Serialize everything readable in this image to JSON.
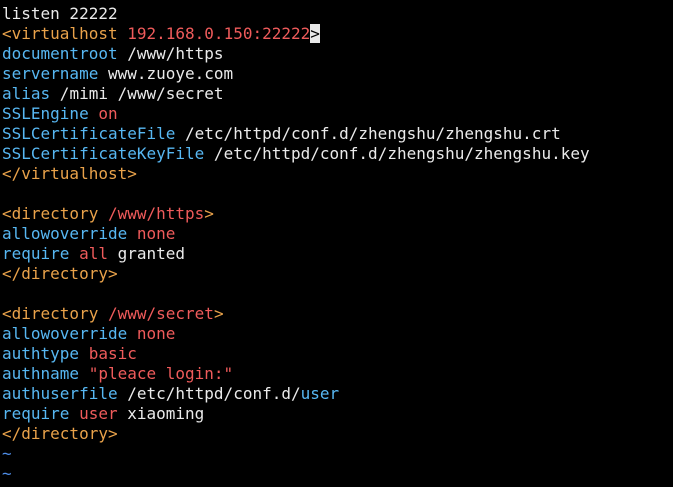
{
  "colors": {
    "background": "#000000",
    "normal": "#eaeaea",
    "keyword": "#57b7f2",
    "value": "#ef5b5b",
    "tag": "#e9a24a",
    "tilde": "#4f8ee8",
    "cursor_bg": "#e8e8e8"
  },
  "editor": {
    "lines": [
      [
        {
          "t": "listen 22222",
          "c": "normal"
        }
      ],
      [
        {
          "t": "<virtualhost ",
          "c": "tag"
        },
        {
          "t": "192.168.0.150:22222",
          "c": "value"
        },
        {
          "t": ">",
          "c": "cursor"
        }
      ],
      [
        {
          "t": "documentroot",
          "c": "keyword"
        },
        {
          "t": " /www/https",
          "c": "normal"
        }
      ],
      [
        {
          "t": "servername",
          "c": "keyword"
        },
        {
          "t": " www.zuoye.com",
          "c": "normal"
        }
      ],
      [
        {
          "t": "alias",
          "c": "keyword"
        },
        {
          "t": " /mimi /www/secret",
          "c": "normal"
        }
      ],
      [
        {
          "t": "SSLEngine",
          "c": "keyword"
        },
        {
          "t": " on",
          "c": "value"
        }
      ],
      [
        {
          "t": "SSLCertificateFile",
          "c": "keyword"
        },
        {
          "t": " /etc/httpd/conf.d/zhengshu/zhengshu.crt",
          "c": "normal"
        }
      ],
      [
        {
          "t": "SSLCertificateKeyFile",
          "c": "keyword"
        },
        {
          "t": " /etc/httpd/conf.d/zhengshu/zhengshu.key",
          "c": "normal"
        }
      ],
      [
        {
          "t": "</virtualhost>",
          "c": "tag"
        }
      ],
      [
        {
          "t": "",
          "c": "normal"
        }
      ],
      [
        {
          "t": "<directory ",
          "c": "tag"
        },
        {
          "t": "/www/https",
          "c": "value"
        },
        {
          "t": ">",
          "c": "tag"
        }
      ],
      [
        {
          "t": "allowoverride",
          "c": "keyword"
        },
        {
          "t": " none",
          "c": "value"
        }
      ],
      [
        {
          "t": "require",
          "c": "keyword"
        },
        {
          "t": " all",
          "c": "value"
        },
        {
          "t": " granted",
          "c": "normal"
        }
      ],
      [
        {
          "t": "</directory>",
          "c": "tag"
        }
      ],
      [
        {
          "t": "",
          "c": "normal"
        }
      ],
      [
        {
          "t": "<directory ",
          "c": "tag"
        },
        {
          "t": "/www/secret",
          "c": "value"
        },
        {
          "t": ">",
          "c": "tag"
        }
      ],
      [
        {
          "t": "allowoverride",
          "c": "keyword"
        },
        {
          "t": " none",
          "c": "value"
        }
      ],
      [
        {
          "t": "authtype",
          "c": "keyword"
        },
        {
          "t": " basic",
          "c": "value"
        }
      ],
      [
        {
          "t": "authname",
          "c": "keyword"
        },
        {
          "t": " \"pleace login:\"",
          "c": "value"
        }
      ],
      [
        {
          "t": "authuserfile",
          "c": "keyword"
        },
        {
          "t": " /etc/httpd/conf.d/",
          "c": "normal"
        },
        {
          "t": "user",
          "c": "keyword"
        }
      ],
      [
        {
          "t": "require",
          "c": "keyword"
        },
        {
          "t": " user",
          "c": "value"
        },
        {
          "t": " xiaoming",
          "c": "normal"
        }
      ],
      [
        {
          "t": "</directory>",
          "c": "tag"
        }
      ],
      [
        {
          "t": "~",
          "c": "tilde"
        }
      ],
      [
        {
          "t": "~",
          "c": "tilde"
        }
      ]
    ]
  }
}
